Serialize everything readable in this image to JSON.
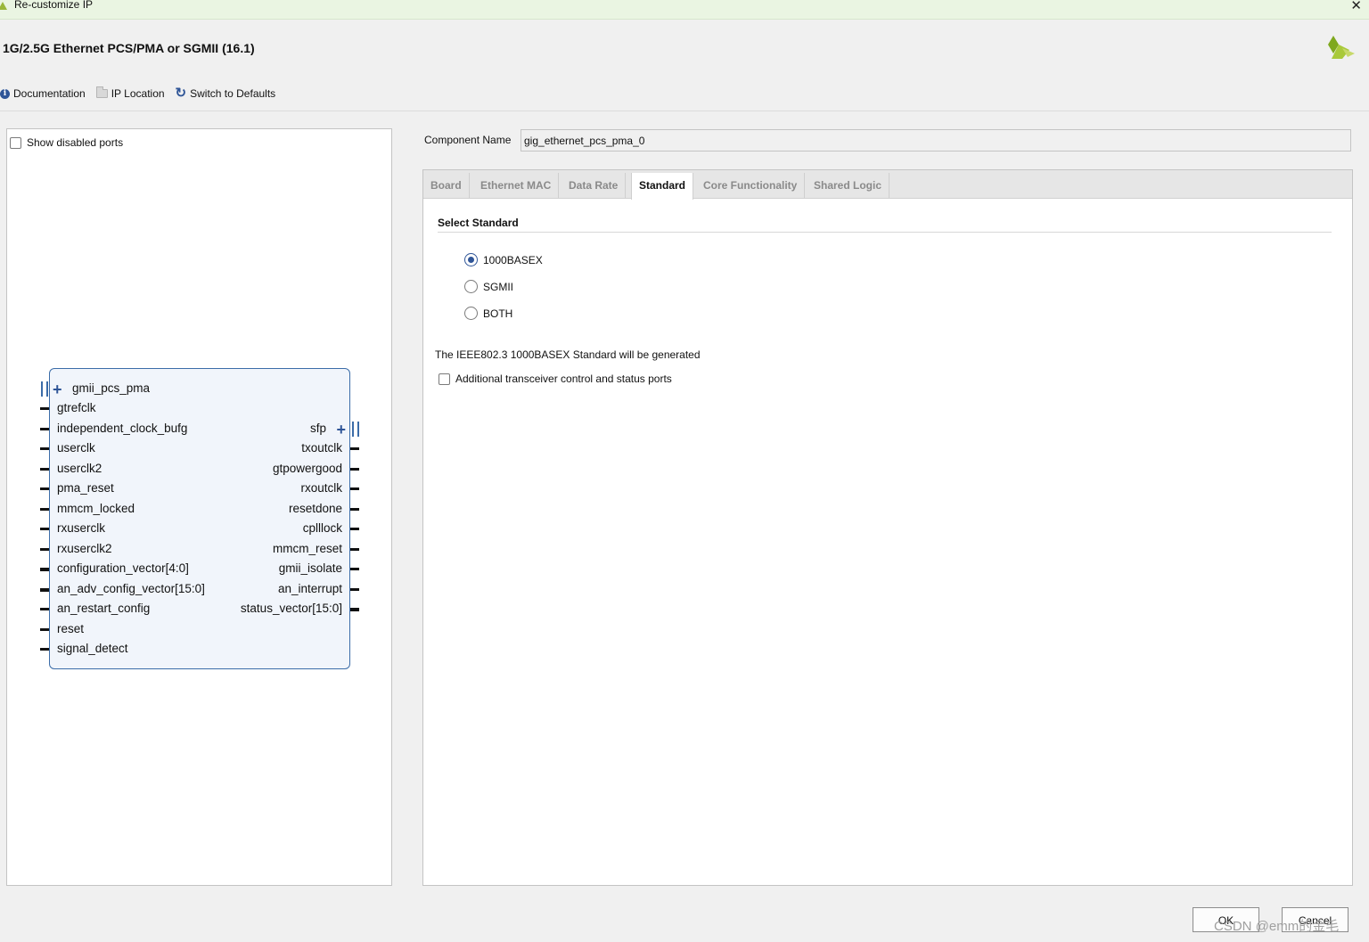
{
  "window": {
    "title": "Re-customize IP",
    "close_glyph": "✕"
  },
  "header": {
    "ip_title": "1G/2.5G Ethernet PCS/PMA or SGMII (16.1)",
    "logo": "xilinx-logo"
  },
  "toolbar": {
    "documentation": "Documentation",
    "ip_location": "IP Location",
    "switch_defaults": "Switch to Defaults"
  },
  "left_panel": {
    "show_disabled_ports": "Show disabled ports",
    "show_disabled_checked": false
  },
  "block": {
    "left_ports": [
      "gmii_pcs_pma",
      "gtrefclk",
      "independent_clock_bufg",
      "userclk",
      "userclk2",
      "pma_reset",
      "mmcm_locked",
      "rxuserclk",
      "rxuserclk2",
      "configuration_vector[4:0]",
      "an_adv_config_vector[15:0]",
      "an_restart_config",
      "reset",
      "signal_detect"
    ],
    "right_ports": [
      "sfp",
      "txoutclk",
      "gtpowergood",
      "rxoutclk",
      "resetdone",
      "cplllock",
      "mmcm_reset",
      "gmii_isolate",
      "an_interrupt",
      "status_vector[15:0]"
    ]
  },
  "component": {
    "label": "Component Name",
    "value": "gig_ethernet_pcs_pma_0"
  },
  "tabs": [
    "Board",
    "Ethernet MAC",
    "Data Rate",
    "Standard",
    "Core Functionality",
    "Shared Logic"
  ],
  "active_tab": "Standard",
  "standard": {
    "section_title": "Select Standard",
    "options": [
      "1000BASEX",
      "SGMII",
      "BOTH"
    ],
    "selected": "1000BASEX",
    "note": "The IEEE802.3 1000BASEX Standard will be generated",
    "additional_ports": "Additional transceiver control and status ports",
    "additional_ports_checked": false
  },
  "buttons": {
    "ok": "OK",
    "cancel": "Cancel"
  },
  "watermark": "CSDN @emm的金毛",
  "colors": {
    "titlebar": "#eaf5e2",
    "accent": "#2f5597",
    "block_fill": "#f1f5fb",
    "block_border": "#3b6ca8"
  }
}
